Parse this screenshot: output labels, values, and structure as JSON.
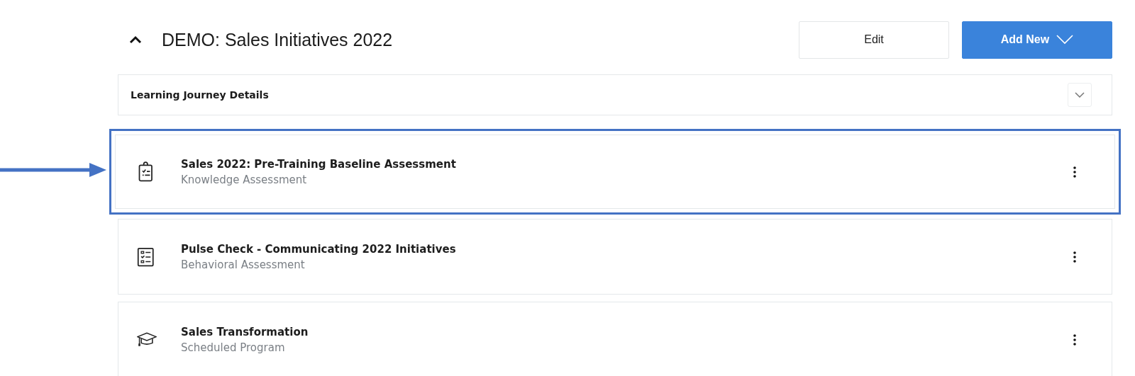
{
  "header": {
    "expanded": true,
    "title": "DEMO: Sales Initiatives 2022",
    "buttons": [
      {
        "kind": "plain",
        "label": "Edit"
      },
      {
        "kind": "dropdown",
        "label": "Add New"
      }
    ]
  },
  "details": {
    "label": "Learning Journey Details",
    "expanded": false
  },
  "items": [
    {
      "kind": "clipboard",
      "title": "Sales 2022: Pre-Training Baseline Assessment",
      "subtitle": "Knowledge Assessment",
      "highlighted": true
    },
    {
      "kind": "checklist",
      "title": "Pulse Check - Communicating 2022 Initiatives",
      "subtitle": "Behavioral Assessment",
      "highlighted": false
    },
    {
      "kind": "cap",
      "title": "Sales Transformation",
      "subtitle": "Scheduled Program",
      "highlighted": false
    }
  ]
}
